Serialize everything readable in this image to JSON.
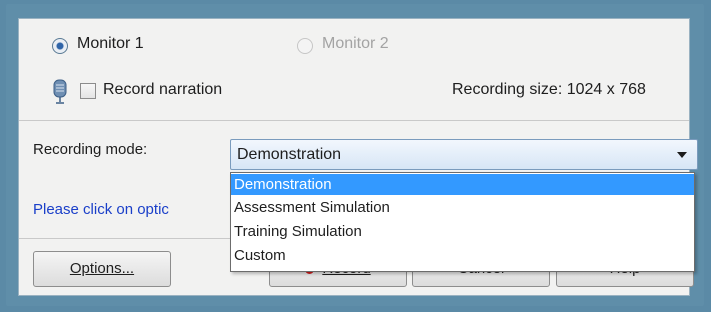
{
  "monitors": {
    "monitor1": "Monitor 1",
    "monitor2": "Monitor 2"
  },
  "narration": {
    "label": "Record narration",
    "checked": false,
    "icon": "microphone-icon"
  },
  "recording_size": "Recording size: 1024 x 768",
  "mode": {
    "label": "Recording mode:",
    "selected": "Demonstration",
    "options": [
      "Demonstration",
      "Assessment Simulation",
      "Training Simulation",
      "Custom"
    ]
  },
  "hint": "Please click on optic",
  "buttons": {
    "options": "Options...",
    "record": "Record",
    "cancel": "Cancel",
    "help": "Help"
  },
  "colors": {
    "selection": "#3399ff",
    "hint": "#1a3fc9",
    "record_dot": "#d01b1b"
  }
}
